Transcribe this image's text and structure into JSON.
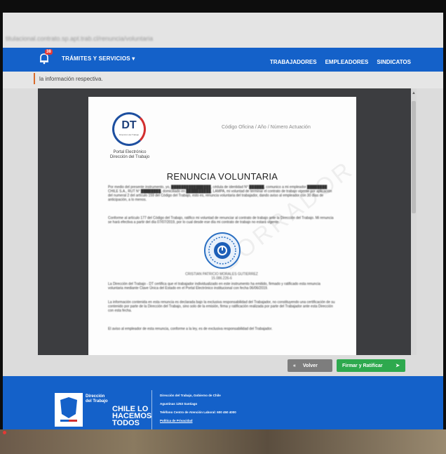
{
  "browser": {
    "url": "titulacional.contrato.sp.apt.trab.cl/renuncia/voluntaria"
  },
  "nav": {
    "notification_count": "38",
    "tramites_label": "TRÁMITES Y SERVICIOS ▾",
    "links": [
      "TRABAJADORES",
      "EMPLEADORES",
      "SINDICATOS"
    ]
  },
  "info": {
    "text": "la información respectiva."
  },
  "document": {
    "logo_text": "DT",
    "logo_sub": "Dirección del Trabajo",
    "portal_line1": "Portal Electrónico",
    "portal_line2": "Dirección del Trabajo",
    "codigo": "Código Oficina / Año / Número Actuación",
    "title": "RENUNCIA VOLUNTARIA",
    "p1": "Por medio del presente instrumento, yo, ████████████████, cédula de identidad N° ██████, comunico a mi empleador ████████ CHILE S.A., RUT N° ████████, domiciliado en ██████████, LAMPA, mi voluntad de terminar el contrato de trabajo vigente por aplicación del numeral 2 del artículo 159 del Código del Trabajo, esto es, renuncia voluntaria del trabajador, dando aviso al empleador con 30 días de anticipación, a lo menos.",
    "p2": "Conforme al artículo 177 del Código del Trabajo, ratifico mi voluntad de renunciar al contrato de trabajo ante la Dirección del Trabajo. Mi renuncia se hará efectiva a partir del día 07/07/2019, por lo cual desde ese día mi contrato de trabajo no estará vigente.",
    "signer_name": "CRISTIAN PATRICIO MORALES GUTIERREZ",
    "signer_id": "15.086.226-6",
    "p3": "La Dirección del Trabajo - DT certifica que el trabajador individualizado en este instrumento ha emitido, firmado y ratificado esta renuncia voluntaria mediante Clave Única del Estado en el Portal Electrónico institucional con fecha 06/06/2019.",
    "p4": "La información contenida en esta renuncia es declarada bajo la exclusiva responsabilidad del Trabajador, no constituyendo una certificación de su contenido por parte de la Dirección del Trabajo, sino solo de la emisión, firma y ratificación realizada por parte del Trabajador ante esta Dirección con esta fecha.",
    "p5": "El aviso al empleador de esta renuncia, conforme a la ley, es de exclusiva responsabilidad del Trabajador.",
    "watermark": "BORRADOR"
  },
  "actions": {
    "back_label": "Volver",
    "sign_label": "Firmar y Ratificar"
  },
  "footer": {
    "logo_line1": "Dirección",
    "logo_line2": "del Trabajo",
    "gob": "Gobierno de Chile",
    "slogan1": "CHILE LO",
    "slogan2": "HACEMOS",
    "slogan3": "TODOS",
    "info1": "Dirección del Trabajo, Gobierno de Chile",
    "info2": "Agustinas 1253 Santiago",
    "info3": "Teléfono Centro de Atención Laboral: 600 450 4000",
    "info4": "Política de Privacidad"
  },
  "colors": {
    "primary_blue": "#1461c9",
    "sign_green": "#2ea94e",
    "back_gray": "#7d7d7d",
    "accent_orange": "#d96b2b"
  }
}
